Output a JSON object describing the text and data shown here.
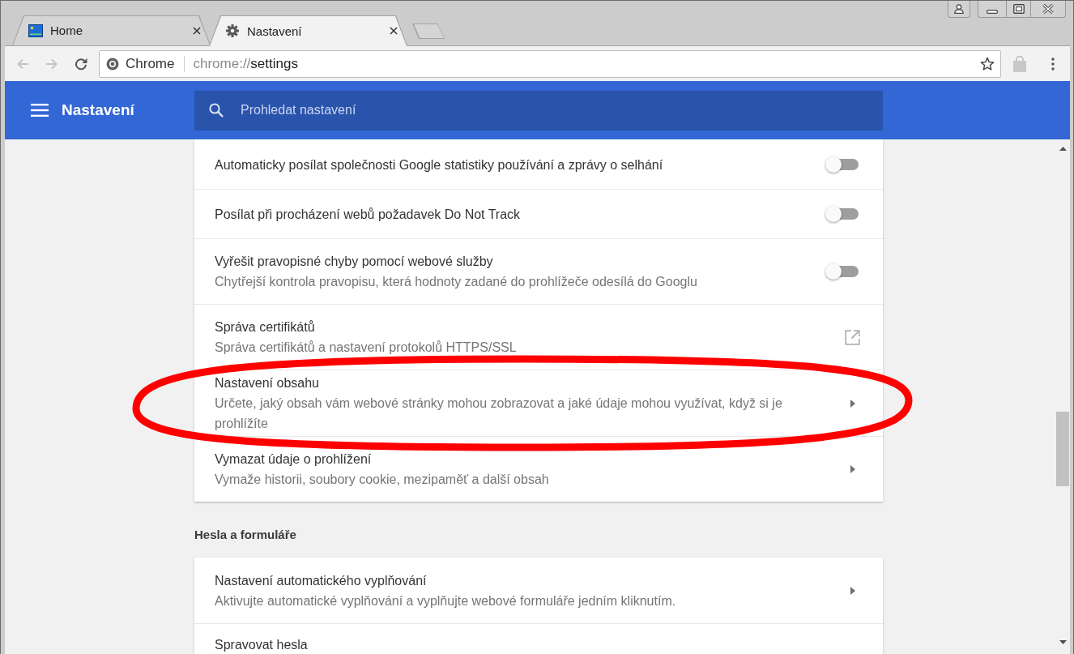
{
  "tabs": [
    {
      "kind": "site",
      "title": "Home",
      "selected": false
    },
    {
      "kind": "settings",
      "title": "Nastavení",
      "selected": true
    }
  ],
  "toolbar": {
    "navigation": [
      {
        "kind": "back",
        "disabled": true
      },
      {
        "kind": "forward",
        "disabled": true
      },
      {
        "kind": "reload",
        "disabled": false
      }
    ],
    "address": {
      "chip": "Chrome",
      "scheme": "chrome://",
      "path": "settings"
    }
  },
  "header": {
    "title": "Nastavení",
    "search": {
      "placeholder": "Prohledat nastavení"
    }
  },
  "sections": [
    {
      "rows": [
        {
          "kind": "toggle",
          "title": "Automaticky posílat společnosti Google statistiky používání a zprávy o selhání",
          "on": false,
          "circled": false
        },
        {
          "kind": "toggle",
          "title": "Posílat při procházení webů požadavek Do Not Track",
          "on": false,
          "circled": false
        },
        {
          "kind": "toggle",
          "title": "Vyřešit pravopisné chyby pomocí webové služby",
          "description": "Chytřejší kontrola pravopisu, která hodnoty zadané do prohlížeče odesílá do Googlu",
          "on": false,
          "circled": false
        },
        {
          "kind": "external",
          "title": "Správa certifikátů",
          "description": "Správa certifikátů a nastavení protokolů HTTPS/SSL",
          "circled": false
        },
        {
          "kind": "submenu",
          "title": "Nastavení obsahu",
          "description": "Určete, jaký obsah vám webové stránky mohou zobrazovat a jaké údaje mohou využívat, když si je prohlížíte",
          "circled": true
        },
        {
          "kind": "submenu",
          "title": "Vymazat údaje o prohlížení",
          "description": "Vymaže historii, soubory cookie, mezipaměť a další obsah",
          "circled": false
        }
      ]
    },
    {
      "heading": "Hesla a formuláře",
      "rows": [
        {
          "kind": "submenu",
          "title": "Nastavení automatického vyplňování",
          "description": "Aktivujte automatické vyplňování a vyplňujte webové formuláře jedním kliknutím.",
          "circled": false
        },
        {
          "kind": "text",
          "title": "Spravovat hesla",
          "circled": false
        }
      ]
    }
  ]
}
